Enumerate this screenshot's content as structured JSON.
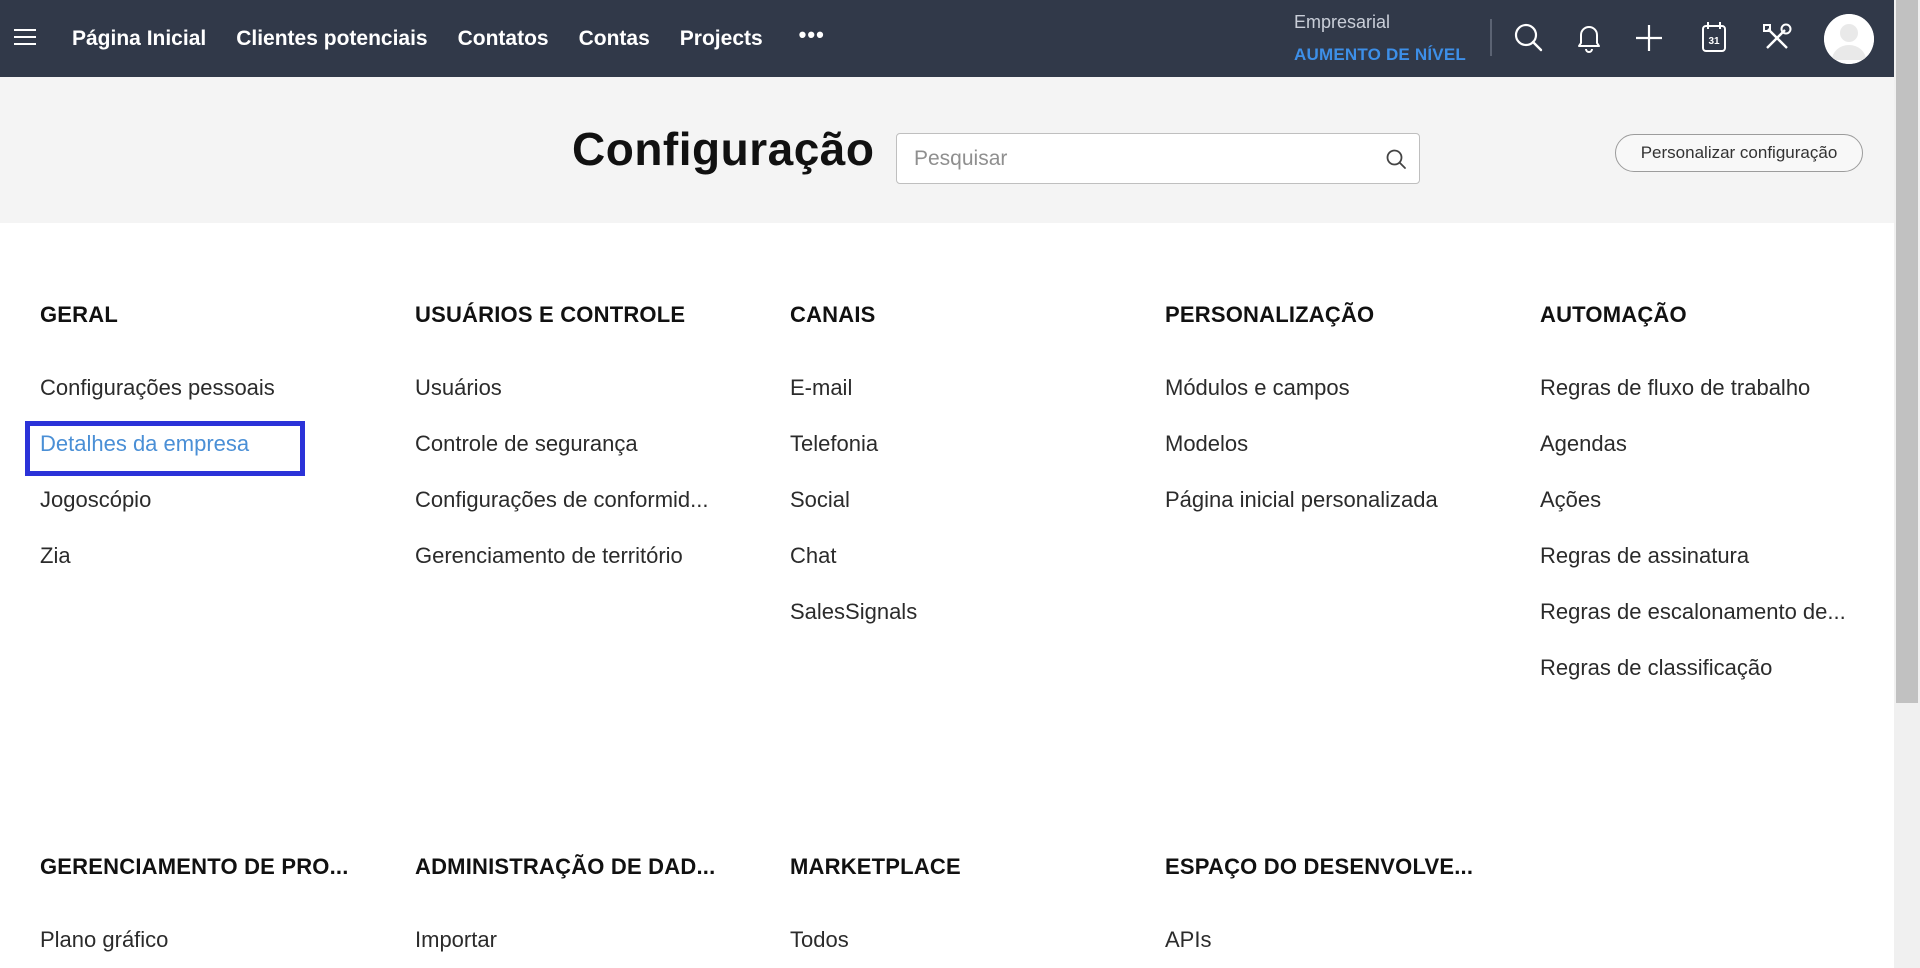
{
  "topbar": {
    "nav": [
      "Página Inicial",
      "Clientes potenciais",
      "Contatos",
      "Contas",
      "Projects"
    ],
    "more_label": "•••",
    "plan_name": "Empresarial",
    "upgrade_label": "AUMENTO DE NÍVEL",
    "calendar_day": "31",
    "icons": [
      "menu-icon",
      "search-icon",
      "bell-icon",
      "plus-icon",
      "calendar-icon",
      "tools-icon",
      "avatar"
    ]
  },
  "header": {
    "title": "Configuração",
    "search_placeholder": "Pesquisar",
    "customize_label": "Personalizar configuração"
  },
  "sections": [
    {
      "title": "GERAL",
      "items": [
        "Configurações pessoais",
        "Detalhes da empresa",
        "Jogoscópio",
        "Zia"
      ]
    },
    {
      "title": "USUÁRIOS E CONTROLE",
      "items": [
        "Usuários",
        "Controle de segurança",
        "Configurações de conformid...",
        "Gerenciamento de território"
      ]
    },
    {
      "title": "CANAIS",
      "items": [
        "E-mail",
        "Telefonia",
        "Social",
        "Chat",
        "SalesSignals"
      ]
    },
    {
      "title": "PERSONALIZAÇÃO",
      "items": [
        "Módulos e campos",
        "Modelos",
        "Página inicial personalizada"
      ]
    },
    {
      "title": "AUTOMAÇÃO",
      "items": [
        "Regras de fluxo de trabalho",
        "Agendas",
        "Ações",
        "Regras de assinatura",
        "Regras de escalonamento de...",
        "Regras de classificação"
      ]
    },
    {
      "title": "GERENCIAMENTO DE PRO...",
      "items": [
        "Plano gráfico"
      ]
    },
    {
      "title": "ADMINISTRAÇÃO DE DAD...",
      "items": [
        "Importar"
      ]
    },
    {
      "title": "MARKETPLACE",
      "items": [
        "Todos"
      ]
    },
    {
      "title": "ESPAÇO DO DESENVOLVE...",
      "items": [
        "APIs"
      ]
    }
  ],
  "highlighted_item": "Detalhes da empresa",
  "colors": {
    "topbar_bg": "#313949",
    "upgrade_link": "#3d8fe8",
    "active_link": "#4a8fd6",
    "highlight_border": "#2b32d8",
    "header_band_bg": "#f4f4f4"
  }
}
